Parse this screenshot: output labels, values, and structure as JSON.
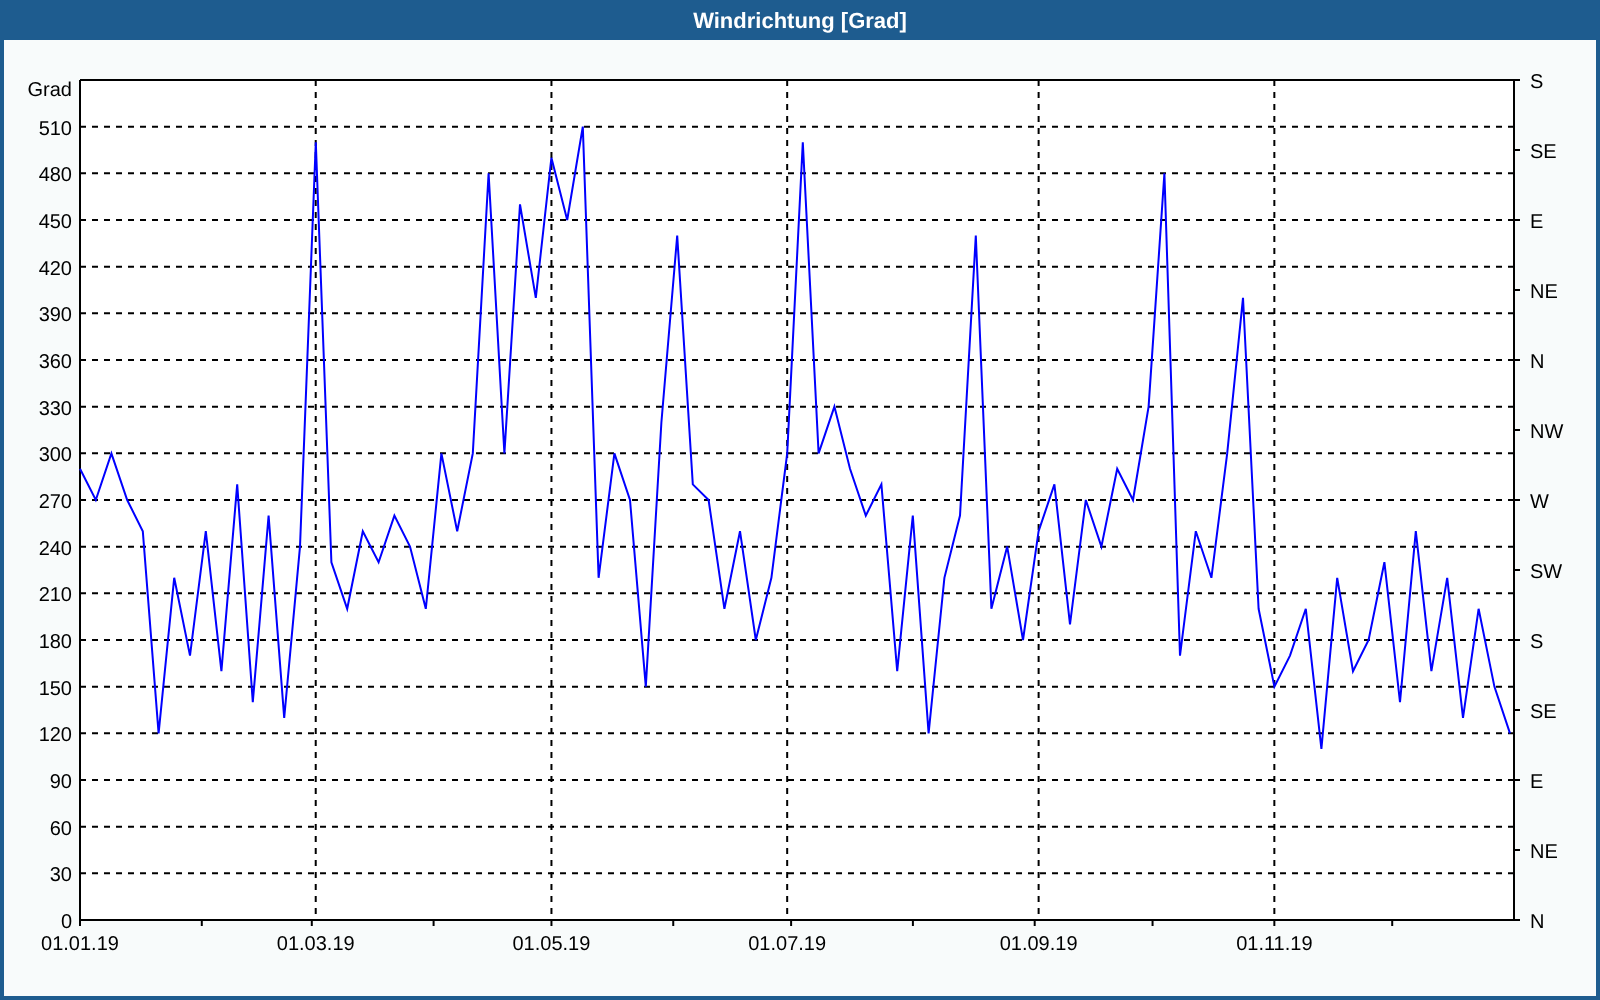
{
  "window": {
    "title": "Windrichtung [Grad]"
  },
  "chart": {
    "right_axis_labels": [
      "S",
      "SE",
      "E",
      "NE",
      "N",
      "NW",
      "W",
      "SW",
      "S",
      "SE",
      "E",
      "NE",
      "N"
    ],
    "chart_data": {
      "type": "line",
      "ylabel": "Grad",
      "ylim": [
        0,
        540
      ],
      "grid": true,
      "yticks": [
        0,
        30,
        60,
        90,
        120,
        150,
        180,
        210,
        240,
        270,
        300,
        330,
        360,
        390,
        420,
        450,
        480,
        510
      ],
      "categories": [
        "01.01.19",
        null,
        null,
        null,
        null,
        null,
        null,
        null,
        null,
        null,
        null,
        null,
        null,
        null,
        null,
        "01.03.19",
        null,
        null,
        null,
        null,
        null,
        null,
        null,
        null,
        null,
        null,
        null,
        null,
        null,
        null,
        "01.05.19",
        null,
        null,
        null,
        null,
        null,
        null,
        null,
        null,
        null,
        null,
        null,
        null,
        null,
        null,
        "01.07.19",
        null,
        null,
        null,
        null,
        null,
        null,
        null,
        null,
        null,
        null,
        null,
        null,
        null,
        null,
        null,
        "01.09.19",
        null,
        null,
        null,
        null,
        null,
        null,
        null,
        null,
        null,
        null,
        null,
        null,
        null,
        null,
        "01.11.19",
        null,
        null,
        null,
        null,
        null,
        null,
        null,
        null,
        null,
        null,
        null,
        null,
        null,
        null,
        null
      ],
      "series": [
        {
          "color": "#0000ff",
          "values": [
            290,
            270,
            300,
            270,
            250,
            120,
            220,
            170,
            250,
            160,
            280,
            140,
            260,
            130,
            240,
            500,
            230,
            200,
            250,
            230,
            260,
            240,
            200,
            300,
            250,
            300,
            480,
            300,
            460,
            400,
            490,
            450,
            510,
            220,
            300,
            270,
            150,
            320,
            440,
            280,
            270,
            200,
            250,
            180,
            220,
            300,
            500,
            300,
            330,
            290,
            260,
            280,
            160,
            260,
            120,
            220,
            260,
            440,
            200,
            240,
            180,
            250,
            280,
            190,
            270,
            240,
            290,
            270,
            330,
            480,
            170,
            250,
            220,
            300,
            400,
            200,
            150,
            170,
            200,
            110,
            220,
            160,
            180,
            230,
            140,
            250,
            160,
            220,
            130,
            200,
            150,
            120
          ]
        }
      ]
    }
  }
}
